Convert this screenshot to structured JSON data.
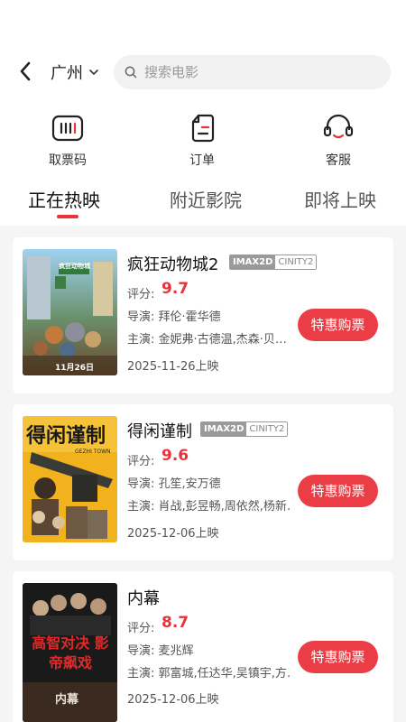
{
  "header": {
    "city": "广州",
    "search_placeholder": "搜索电影"
  },
  "quick_actions": [
    {
      "label": "取票码",
      "icon": "ticket-code-icon"
    },
    {
      "label": "订单",
      "icon": "order-icon"
    },
    {
      "label": "客服",
      "icon": "headset-icon"
    }
  ],
  "tabs": [
    {
      "label": "正在热映",
      "active": true
    },
    {
      "label": "附近影院",
      "active": false
    },
    {
      "label": "即将上映",
      "active": false
    }
  ],
  "movies": [
    {
      "title": "疯狂动物城2",
      "tags": [
        "IMAX2D",
        "CINITY2"
      ],
      "score_label": "评分:",
      "score": "9.7",
      "director_line": "导演:  拜伦·霍华德",
      "cast_line": "主演:  金妮弗·古德温,杰森·贝…",
      "release": "2025-11-26上映",
      "buy_label": "特惠购票",
      "poster_text": "11月26日",
      "poster_badge": "疯狂动物城"
    },
    {
      "title": "得闲谨制",
      "tags": [
        "IMAX2D",
        "CINITY2"
      ],
      "score_label": "评分:",
      "score": "9.6",
      "director_line": "导演:  孔笙,安万德",
      "cast_line": "主演:  肖战,彭昱畅,周依然,杨新…",
      "release": "2025-12-06上映",
      "buy_label": "特惠购票",
      "poster_text": "得闲谨制",
      "poster_badge": "GEZHI TOWN"
    },
    {
      "title": "内幕",
      "tags": [],
      "score_label": "评分:",
      "score": "8.7",
      "director_line": "导演:  麦兆辉",
      "cast_line": "主演:  郭富城,任达华,吴镇宇,方…",
      "release": "2025-12-06上映",
      "buy_label": "特惠购票",
      "poster_text": "高智对决 影帝飙戏",
      "poster_badge": "内幕"
    }
  ],
  "colors": {
    "accent": "#e8333a",
    "button": "#ea3d45"
  }
}
